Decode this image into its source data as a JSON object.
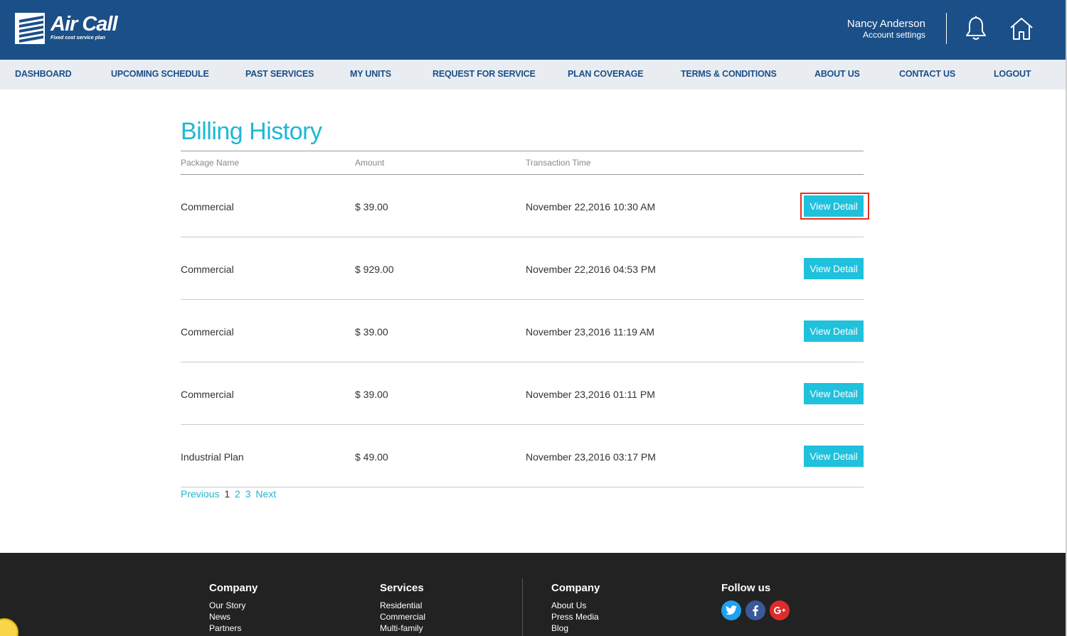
{
  "brand": {
    "name": "Air Call",
    "tagline": "Fixed cost service plan"
  },
  "user": {
    "name": "Nancy Anderson",
    "settings_label": "Account settings"
  },
  "nav": [
    "DASHBOARD",
    "UPCOMING SCHEDULE",
    "PAST SERVICES",
    "MY UNITS",
    "REQUEST FOR SERVICE",
    "PLAN COVERAGE",
    "TERMS & CONDITIONS",
    "ABOUT US",
    "CONTACT US",
    "LOGOUT"
  ],
  "page": {
    "title": "Billing History"
  },
  "table": {
    "headers": [
      "Package Name",
      "Amount",
      "Transaction Time"
    ],
    "rows": [
      {
        "package": "Commercial",
        "amount": "$ 39.00",
        "time": "November 22,2016 10:30 AM",
        "action": "View Detail"
      },
      {
        "package": "Commercial",
        "amount": "$ 929.00",
        "time": "November 22,2016 04:53 PM",
        "action": "View Detail"
      },
      {
        "package": "Commercial",
        "amount": "$ 39.00",
        "time": "November 23,2016 11:19 AM",
        "action": "View Detail"
      },
      {
        "package": "Commercial",
        "amount": "$ 39.00",
        "time": "November 23,2016 01:11 PM",
        "action": "View Detail"
      },
      {
        "package": "Industrial Plan",
        "amount": "$ 49.00",
        "time": "November 23,2016 03:17 PM",
        "action": "View Detail"
      }
    ]
  },
  "pagination": {
    "previous": "Previous",
    "pages": [
      "1",
      "2",
      "3"
    ],
    "current": "1",
    "next": "Next"
  },
  "footer": {
    "col1": {
      "heading": "Company",
      "links": [
        "Our Story",
        "News",
        "Partners"
      ]
    },
    "col2": {
      "heading": "Services",
      "links": [
        "Residential",
        "Commercial",
        "Multi-family"
      ]
    },
    "col3": {
      "heading": "Company",
      "links": [
        "About Us",
        "Press Media",
        "Blog"
      ]
    },
    "col4": {
      "heading": "Follow us",
      "icons": [
        "twitter-icon",
        "facebook-icon",
        "google-plus-icon"
      ]
    }
  },
  "colors": {
    "header_bg": "#1b4f88",
    "accent": "#1fc1dc",
    "highlight_border": "#e8321e",
    "footer_bg": "#222222"
  }
}
